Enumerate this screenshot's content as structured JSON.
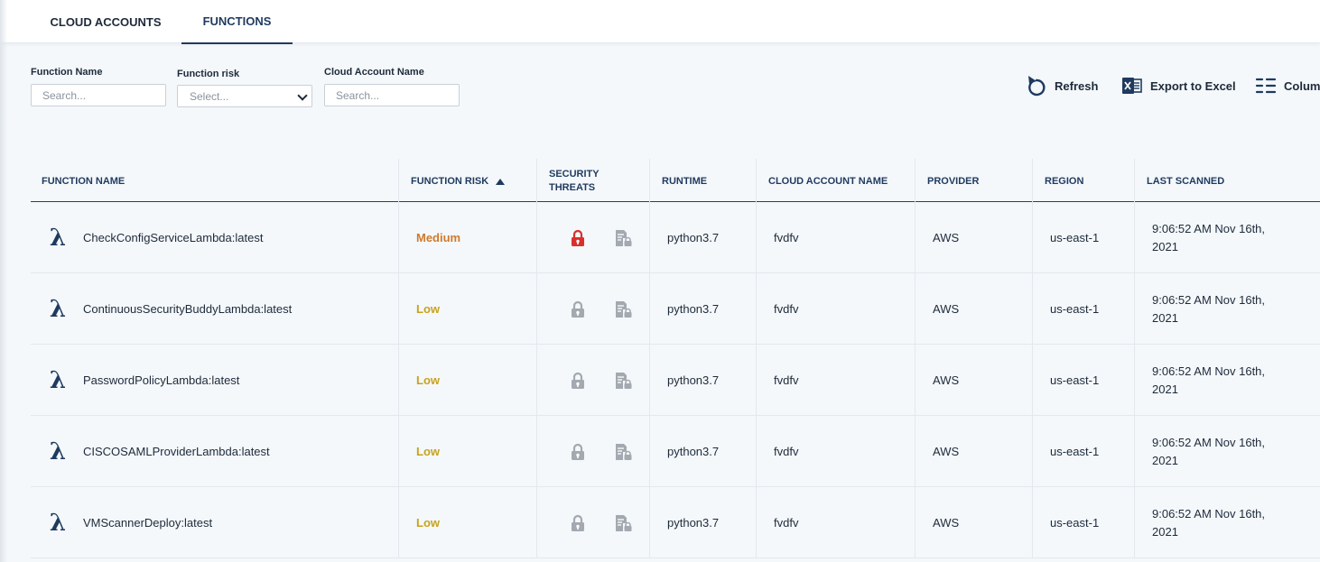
{
  "tabs": [
    {
      "label": "CLOUD ACCOUNTS",
      "active": false
    },
    {
      "label": "FUNCTIONS",
      "active": true
    }
  ],
  "filters": {
    "function_name": {
      "label": "Function Name",
      "placeholder": "Search..."
    },
    "function_risk": {
      "label": "Function risk",
      "placeholder": "Select..."
    },
    "cloud_account_name": {
      "label": "Cloud Account Name",
      "placeholder": "Search..."
    }
  },
  "toolbar": {
    "refresh": "Refresh",
    "export": "Export to Excel",
    "columns": "Colum"
  },
  "table": {
    "headers": {
      "function_name": "FUNCTION NAME",
      "function_risk": "FUNCTION RISK",
      "security_threats": "SECURITY\nTHREATS",
      "runtime": "RUNTIME",
      "cloud_account_name": "CLOUD ACCOUNT NAME",
      "provider": "PROVIDER",
      "region": "REGION",
      "last_scanned": "LAST SCANNED"
    },
    "sort": {
      "column": "function_risk",
      "direction": "ascending"
    },
    "rows": [
      {
        "name": "CheckConfigServiceLambda:latest",
        "risk": "Medium",
        "threat_active": true,
        "runtime": "python3.7",
        "account": "fvdfv",
        "provider": "AWS",
        "region": "us-east-1",
        "last_scanned": "9:06:52 AM Nov 16th,\n2021"
      },
      {
        "name": "ContinuousSecurityBuddyLambda:latest",
        "risk": "Low",
        "threat_active": false,
        "runtime": "python3.7",
        "account": "fvdfv",
        "provider": "AWS",
        "region": "us-east-1",
        "last_scanned": "9:06:52 AM Nov 16th,\n2021"
      },
      {
        "name": "PasswordPolicyLambda:latest",
        "risk": "Low",
        "threat_active": false,
        "runtime": "python3.7",
        "account": "fvdfv",
        "provider": "AWS",
        "region": "us-east-1",
        "last_scanned": "9:06:52 AM Nov 16th,\n2021"
      },
      {
        "name": "CISCOSAMLProviderLambda:latest",
        "risk": "Low",
        "threat_active": false,
        "runtime": "python3.7",
        "account": "fvdfv",
        "provider": "AWS",
        "region": "us-east-1",
        "last_scanned": "9:06:52 AM Nov 16th,\n2021"
      },
      {
        "name": "VMScannerDeploy:latest",
        "risk": "Low",
        "threat_active": false,
        "runtime": "python3.7",
        "account": "fvdfv",
        "provider": "AWS",
        "region": "us-east-1",
        "last_scanned": "9:06:52 AM Nov 16th,\n2021"
      }
    ]
  },
  "colors": {
    "primary": "#1f3a5f",
    "risk_medium": "#d07a2c",
    "risk_low": "#c9a21c",
    "threat_active": "#d9302c",
    "threat_inactive": "#a3a9b0",
    "excel_icon": "#1f3a5f"
  },
  "icons": {
    "function": "lambda-icon",
    "lock": "lock-icon",
    "policy": "document-lock-icon",
    "refresh": "refresh-icon",
    "excel": "excel-icon",
    "columns": "columns-icon"
  }
}
